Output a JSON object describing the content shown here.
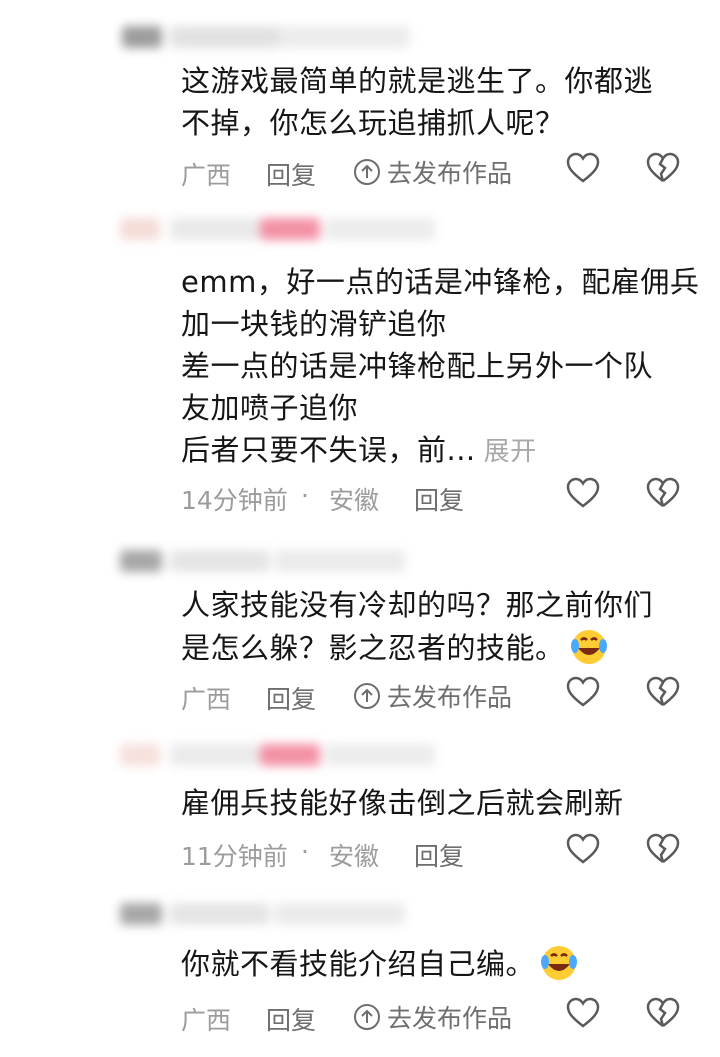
{
  "comments": [
    {
      "lines": [
        "这游戏最简单的就是逃生了。你都逃",
        "不掉，你怎么玩追捕抓人呢？"
      ],
      "location": "广西",
      "reply_label": "回复",
      "goto_label": "去发布作品"
    },
    {
      "lines": [
        "emm，好一点的话是冲锋枪，配雇佣兵",
        "加一块钱的滑铲追你",
        "差一点的话是冲锋枪配上另外一个队",
        "友加喷子追你",
        "后者只要不失误，前..."
      ],
      "expand_label": "展开",
      "time": "14分钟前",
      "dot": "·",
      "location": "安徽",
      "reply_label": "回复"
    },
    {
      "lines": [
        "人家技能没有冷却的吗？那之前你们",
        "是怎么躲？影之忍者的技能。"
      ],
      "emoji": "laugh-cry",
      "location": "广西",
      "reply_label": "回复",
      "goto_label": "去发布作品"
    },
    {
      "lines": [
        "雇佣兵技能好像击倒之后就会刷新"
      ],
      "time": "11分钟前",
      "dot": "·",
      "location": "安徽",
      "reply_label": "回复"
    },
    {
      "lines": [
        "你就不看技能介绍自己编。"
      ],
      "emoji": "laugh-cry",
      "location": "广西",
      "reply_label": "回复",
      "goto_label": "去发布作品"
    }
  ],
  "icons": {
    "like": "heart-outline-icon",
    "dislike": "broken-heart-outline-icon",
    "goto": "arrow-up-circle-icon"
  },
  "colors": {
    "meta_gray": "#9c9c9c",
    "expand_gray": "#a8a8a8",
    "icon_gray": "#5a5a5a",
    "blur_pink": "#f06c87"
  }
}
